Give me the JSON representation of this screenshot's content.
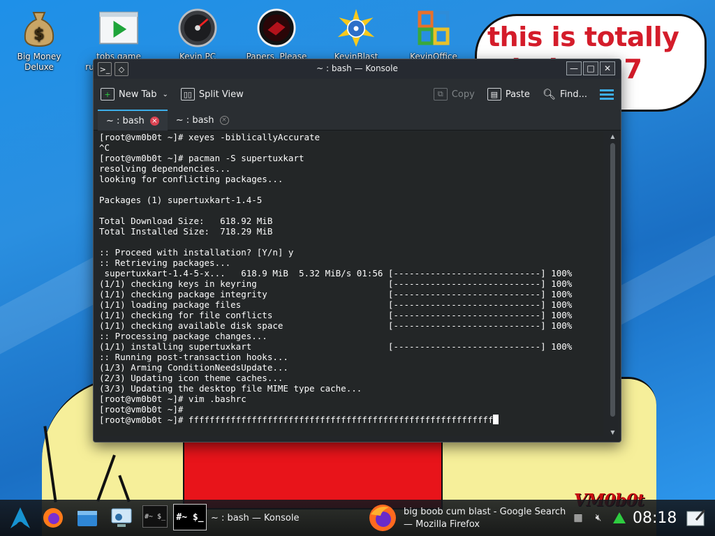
{
  "desktop": {
    "icons": [
      {
        "label": "Big Money Deluxe",
        "icon": "money-bag-icon"
      },
      {
        "label": "tobs game russian tens a...",
        "icon": "play-icon"
      },
      {
        "label": "Kevin PC Optimizer Ho...",
        "icon": "gauge-icon"
      },
      {
        "label": "Papers, Please",
        "icon": "papers-please-icon"
      },
      {
        "label": "KevinBlast Launcher",
        "icon": "disc-star-icon"
      },
      {
        "label": "KevinOffice 2009",
        "icon": "office-icon"
      }
    ],
    "bubble_text": "this is totally windows 7 guys"
  },
  "window": {
    "title": "~ : bash — Konsole",
    "toolbar": {
      "new_tab": "New Tab",
      "split_view": "Split View",
      "copy": "Copy",
      "paste": "Paste",
      "find": "Find..."
    },
    "tabs": [
      {
        "label": "~ : bash",
        "active": true
      },
      {
        "label": "~ : bash",
        "active": false
      }
    ],
    "terminal_lines": [
      "[root@vm0b0t ~]# xeyes -biblicallyAccurate",
      "^C",
      "[root@vm0b0t ~]# pacman -S supertuxkart",
      "resolving dependencies...",
      "looking for conflicting packages...",
      "",
      "Packages (1) supertuxkart-1.4-5",
      "",
      "Total Download Size:   618.92 MiB",
      "Total Installed Size:  718.29 MiB",
      "",
      ":: Proceed with installation? [Y/n] y",
      ":: Retrieving packages...",
      " supertuxkart-1.4-5-x...   618.9 MiB  5.32 MiB/s 01:56 [----------------------------] 100%",
      "(1/1) checking keys in keyring                         [----------------------------] 100%",
      "(1/1) checking package integrity                       [----------------------------] 100%",
      "(1/1) loading package files                            [----------------------------] 100%",
      "(1/1) checking for file conflicts                      [----------------------------] 100%",
      "(1/1) checking available disk space                    [----------------------------] 100%",
      ":: Processing package changes...",
      "(1/1) installing supertuxkart                          [----------------------------] 100%",
      ":: Running post-transaction hooks...",
      "(1/3) Arming ConditionNeedsUpdate...",
      "(2/3) Updating icon theme caches...",
      "(3/3) Updating the desktop file MIME type cache...",
      "[root@vm0b0t ~]# vim .bashrc",
      "[root@vm0b0t ~]#",
      "[root@vm0b0t ~]# ffffffffffffffffffffffffffffffffffffffffffffffffffffffffff"
    ]
  },
  "taskbar": {
    "konsole_task": "~ : bash — Konsole",
    "firefox_task_line1": "big boob cum blast - Google Search",
    "firefox_task_line2": "— Mozilla Firefox",
    "clock": "08:18",
    "watermark": "VM0b0t"
  },
  "colors": {
    "accent": "#3daee9",
    "terminal_bg": "#232627",
    "bubble_text": "#d41c2a",
    "close_red": "#da4453"
  }
}
